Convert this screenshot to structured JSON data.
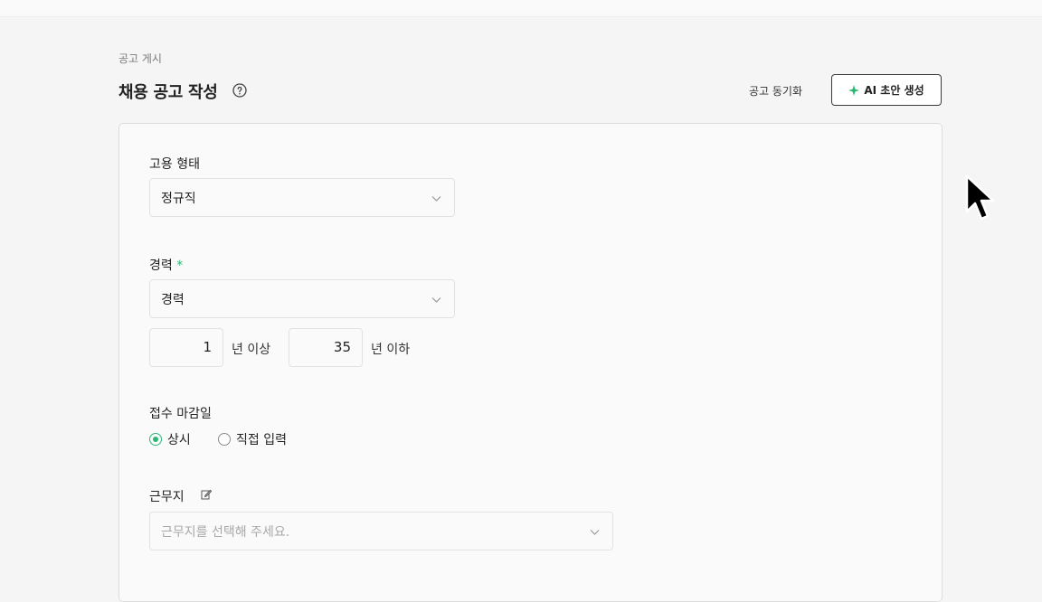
{
  "breadcrumb": "공고 게시",
  "header": {
    "title": "채용 공고 작성",
    "help_icon": "question-circle-icon",
    "sync_label": "공고 동기화",
    "ai_button_label": "AI 초안 생성",
    "ai_icon": "sparkle-icon",
    "accent_color": "#2bb673"
  },
  "form": {
    "employment_type": {
      "label": "고용 형태",
      "value": "정규직"
    },
    "career": {
      "label": "경력",
      "required_mark": "*",
      "value": "경력",
      "min_years": "1",
      "min_unit": "년 이상",
      "max_years": "35",
      "max_unit": "년 이하"
    },
    "deadline": {
      "label": "접수 마감일",
      "options": [
        "상시",
        "직접 입력"
      ],
      "selected": "상시"
    },
    "location": {
      "label": "근무지",
      "edit_icon": "edit-icon",
      "placeholder": "근무지를 선택해 주세요."
    }
  }
}
